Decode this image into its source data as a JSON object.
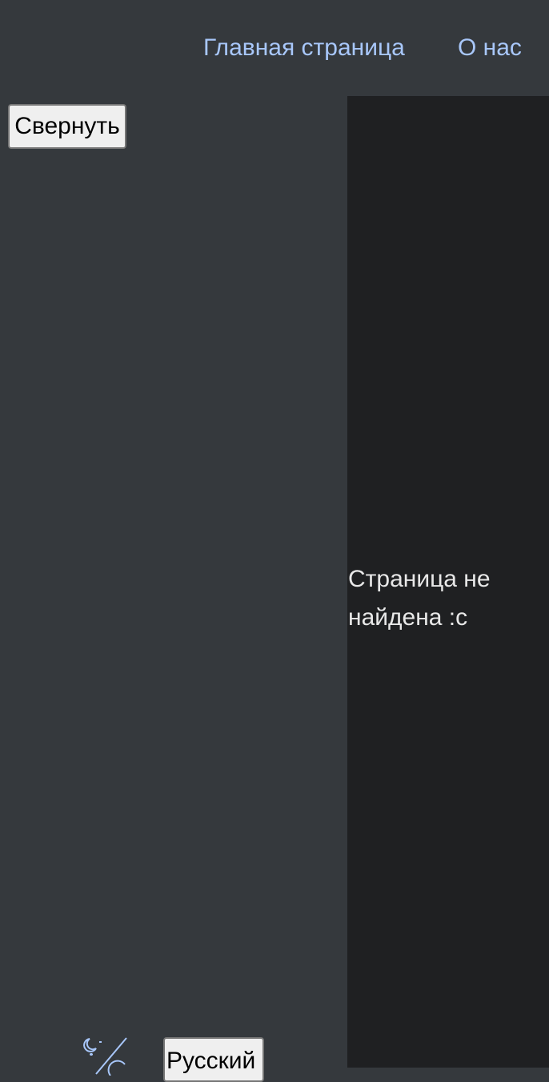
{
  "header": {
    "nav": {
      "home_label": "Главная страница",
      "about_label": "О нас"
    },
    "link_color": "#a8c7fa"
  },
  "sidebar": {
    "collapse_label": "Свернуть",
    "theme_toggle_icon": "moon-sun-toggle-icon",
    "language_selected": "Русский"
  },
  "main": {
    "message": "Страница не найдена :с"
  },
  "colors": {
    "sidebar_bg": "#35393d",
    "content_bg": "#1f2022",
    "accent": "#a8c7fa"
  }
}
